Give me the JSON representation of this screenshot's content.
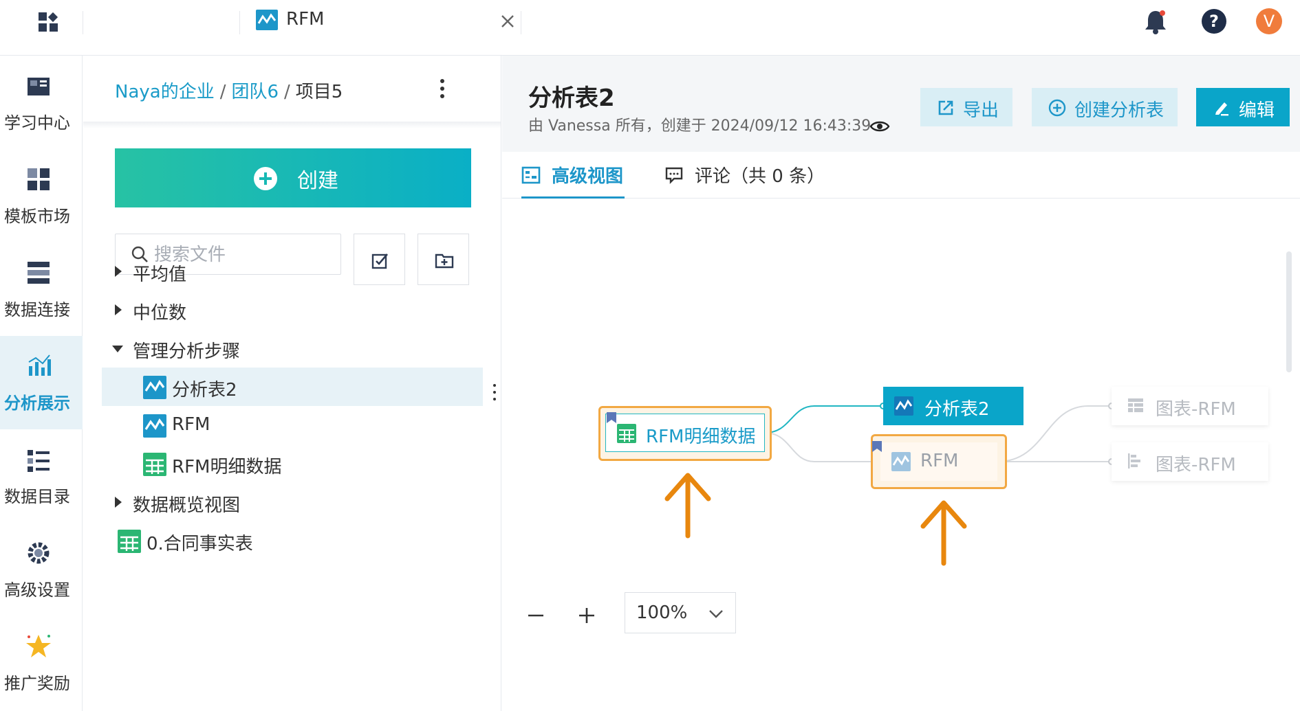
{
  "topbar": {
    "tab_title": "RFM",
    "avatar_letter": "V"
  },
  "nav": {
    "items": [
      {
        "label": "学习中心",
        "icon": "book-icon"
      },
      {
        "label": "模板市场",
        "icon": "template-icon"
      },
      {
        "label": "数据连接",
        "icon": "data-connect-icon"
      },
      {
        "label": "分析展示",
        "icon": "analysis-icon",
        "active": true
      },
      {
        "label": "数据目录",
        "icon": "catalog-icon"
      },
      {
        "label": "高级设置",
        "icon": "settings-gear-icon"
      },
      {
        "label": "推广奖励",
        "icon": "star-reward-icon"
      }
    ]
  },
  "panel": {
    "breadcrumb": [
      "Naya的企业",
      "团队6",
      "项目5"
    ],
    "breadcrumb_sep": "/",
    "create_label": "创建",
    "search_placeholder": "搜索文件",
    "tree": [
      {
        "label": "平均值",
        "type": "folder",
        "expanded": false
      },
      {
        "label": "中位数",
        "type": "folder",
        "expanded": false
      },
      {
        "label": "管理分析步骤",
        "type": "folder",
        "expanded": true
      },
      {
        "label": "分析表2",
        "type": "analysis",
        "selected": true
      },
      {
        "label": "RFM",
        "type": "analysis"
      },
      {
        "label": "RFM明细数据",
        "type": "table"
      },
      {
        "label": "数据概览视图",
        "type": "folder",
        "expanded": false
      },
      {
        "label": "0.合同事实表",
        "type": "table"
      }
    ]
  },
  "main": {
    "title": "分析表2",
    "meta": "由 Vanessa 所有，创建于 2024/09/12 16:43:39",
    "buttons": {
      "export": "导出",
      "create_sheet": "创建分析表",
      "edit": "编辑"
    },
    "tabs": {
      "advanced": "高级视图",
      "comments": "评论（共 0 条）"
    },
    "zoom": "100%",
    "colors": {
      "accent": "#1d96c9",
      "highlight": "#f2a842",
      "arrow": "#e8870e"
    }
  },
  "lineage": {
    "nodes": {
      "rfm_detail": "RFM明细数据",
      "analysis2": "分析表2",
      "rfm": "RFM",
      "chart1": "图表-RFM",
      "chart2": "图表-RFM"
    }
  }
}
